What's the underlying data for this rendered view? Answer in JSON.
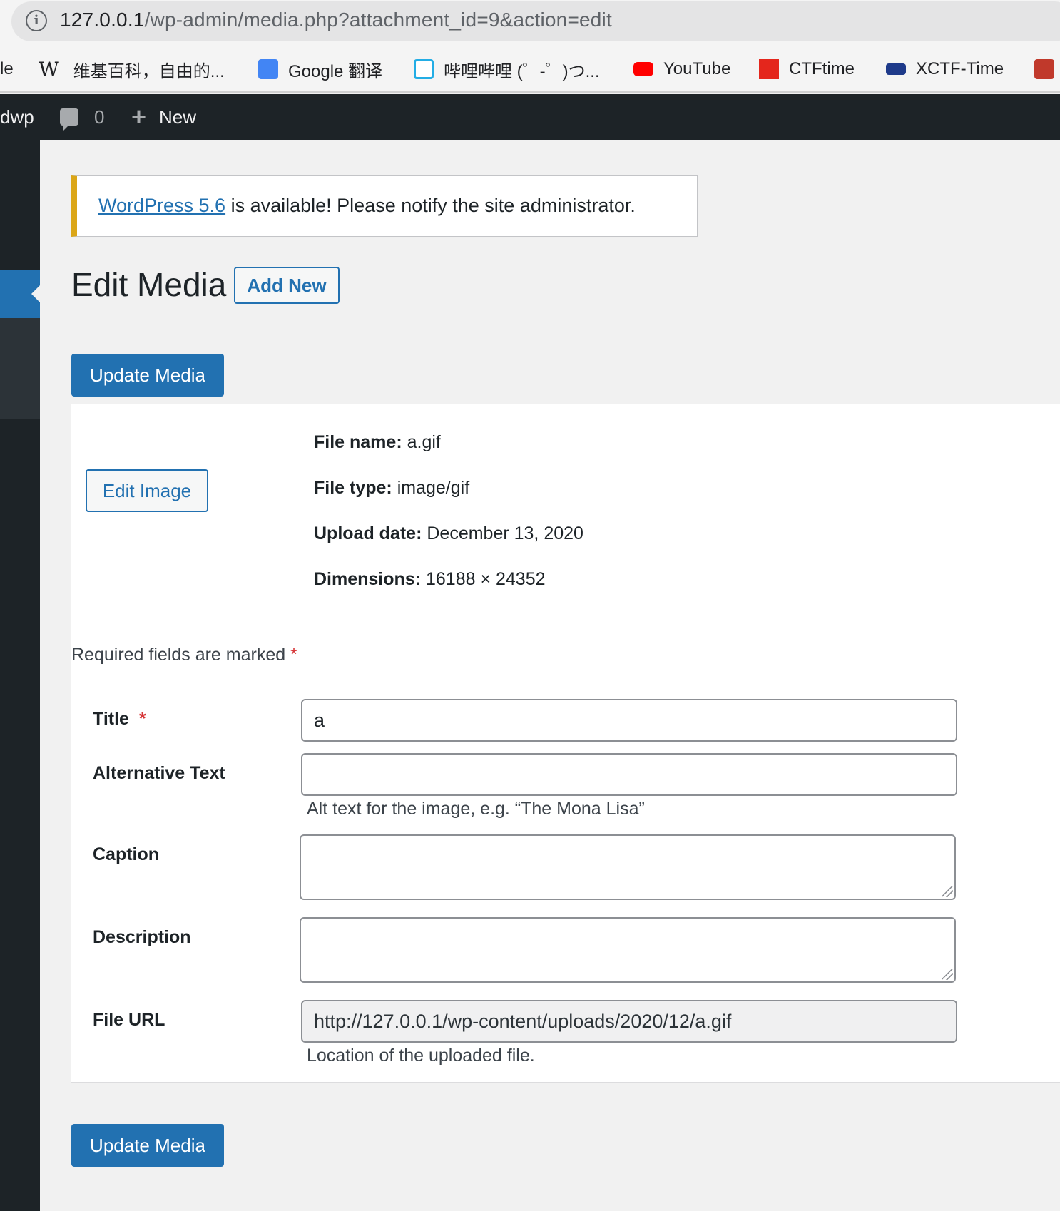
{
  "browser": {
    "url_host": "127.0.0.1",
    "url_path": "/wp-admin/media.php?attachment_id=9&action=edit",
    "bookmarks": [
      {
        "label": "le",
        "icon": "truncated-bookmark"
      },
      {
        "label": "维基百科，自由的...",
        "icon": "wikipedia-icon"
      },
      {
        "label": "Google 翻译",
        "icon": "google-translate-icon"
      },
      {
        "label": "哔哩哔哩 (゜-゜)つ...",
        "icon": "bilibili-icon"
      },
      {
        "label": "YouTube",
        "icon": "youtube-icon"
      },
      {
        "label": "CTFtime",
        "icon": "ctftime-icon"
      },
      {
        "label": "XCTF-Time",
        "icon": "xctf-icon"
      }
    ]
  },
  "adminbar": {
    "site_name": "dwp",
    "comments_count": "0",
    "new_label": "New"
  },
  "notice": {
    "link_text": "WordPress 5.6",
    "message": " is available! Please notify the site administrator."
  },
  "page": {
    "title": "Edit Media",
    "add_new_label": "Add New",
    "update_label": "Update Media",
    "edit_image_label": "Edit Image"
  },
  "file_meta": {
    "file_name_label": "File name:",
    "file_name": "a.gif",
    "file_type_label": "File type:",
    "file_type": "image/gif",
    "upload_date_label": "Upload date:",
    "upload_date": "December 13, 2020",
    "dimensions_label": "Dimensions:",
    "dimensions": "16188 × 24352"
  },
  "form": {
    "required_note": "Required fields are marked",
    "required_star": "*",
    "title_label": "Title",
    "title_value": "a",
    "alt_label": "Alternative Text",
    "alt_value": "",
    "alt_help": "Alt text for the image, e.g. “The Mona Lisa”",
    "caption_label": "Caption",
    "description_label": "Description",
    "file_url_label": "File URL",
    "file_url_value": "http://127.0.0.1/wp-content/uploads/2020/12/a.gif",
    "file_url_help": "Location of the uploaded file."
  },
  "colors": {
    "wp_blue": "#2271b1",
    "admin_dark": "#1d2327",
    "notice_warning": "#dba617",
    "required_red": "#d63638"
  }
}
